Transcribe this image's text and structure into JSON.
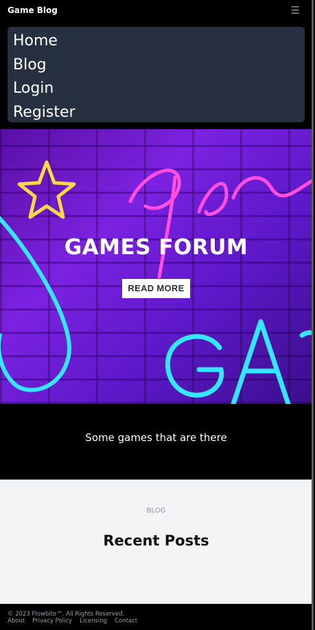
{
  "navbar": {
    "brand": "Game Blog",
    "menu": [
      {
        "label": "Home"
      },
      {
        "label": "Blog"
      },
      {
        "label": "Login"
      },
      {
        "label": "Register"
      }
    ]
  },
  "hero": {
    "title": "GAMES FORUM",
    "button_label": "READ MORE"
  },
  "description": {
    "text": "Some games that are there"
  },
  "blog": {
    "kicker": "BLOG",
    "title": "Recent Posts"
  },
  "footer": {
    "copyright": "© 2023 Flowbite™. All Rights Reserved.",
    "links": [
      {
        "label": "About"
      },
      {
        "label": "Privacy Policy"
      },
      {
        "label": "Licensing"
      },
      {
        "label": "Contact"
      }
    ]
  },
  "colors": {
    "menu_bg": "#263040",
    "neon_pink": "#ff4fe0",
    "neon_cyan": "#35e6ff",
    "neon_yellow": "#ffd84a"
  }
}
